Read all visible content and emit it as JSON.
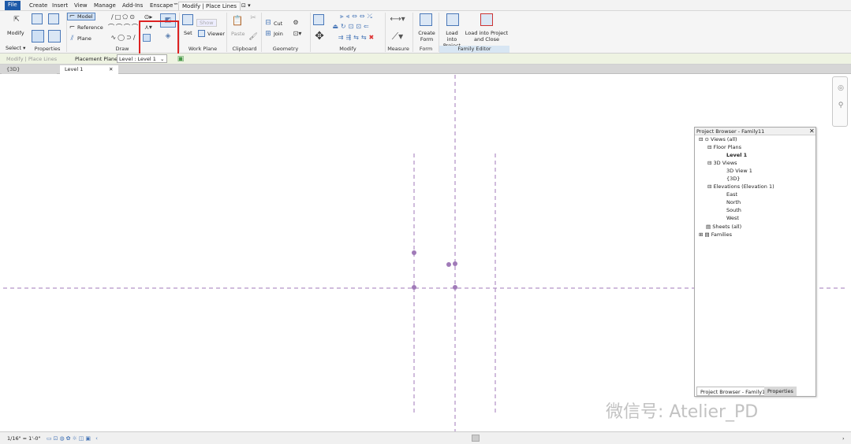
{
  "menu": {
    "tabs": [
      "File",
      "Create",
      "Insert",
      "View",
      "Manage",
      "Add-Ins",
      "Enscape™",
      "Modify | Place Lines",
      "⊡ ▾"
    ],
    "active": "Modify | Place Lines"
  },
  "ribbon": {
    "modify_label": "Modify",
    "select_label": "Select ▾",
    "properties_label": "Properties",
    "draw_label": "Draw",
    "model_label": "Model",
    "reference_label": "Reference",
    "plane_label": "Plane",
    "set_label": "Set",
    "show_label": "Show",
    "viewer_label": "Viewer",
    "workplane_label": "Work Plane",
    "paste_label": "Paste",
    "clipboard_label": "Clipboard",
    "cut_label": "Cut",
    "join_label": "Join",
    "geometry_label": "Geometry",
    "modify_group_label": "Modify",
    "measure_label": "Measure",
    "create_form_label": "Create Form",
    "form_label": "Form",
    "load_into_project_label": "Load into Project",
    "load_into_project_close_label": "Load into Project and Close",
    "family_editor_label": "Family Editor"
  },
  "options": {
    "context": "Modify | Place Lines",
    "placement_plane_label": "Placement Plane:",
    "placement_plane_value": "Level : Level 1"
  },
  "view_tabs": [
    {
      "label": "{3D}"
    },
    {
      "label": "Level 1"
    }
  ],
  "project_browser": {
    "title": "Project Browser - Family11",
    "items": {
      "views": "Views (all)",
      "floor_plans": "Floor Plans",
      "level1": "Level 1",
      "views3d": "3D Views",
      "view3d1": "3D View 1",
      "view3d": "{3D}",
      "elevations": "Elevations (Elevation 1)",
      "east": "East",
      "north": "North",
      "south": "South",
      "west": "West",
      "sheets": "Sheets (all)",
      "families": "Families"
    },
    "tab_browser": "Project Browser - Family11",
    "tab_properties": "Properties"
  },
  "status": {
    "scale": "1/16\" = 1'-0\""
  },
  "watermark": "微信号: Atelier_PD",
  "colors": {
    "file_tab": "#1e5aa8",
    "guide": "#a07ab8",
    "highlight": "#d22222"
  }
}
